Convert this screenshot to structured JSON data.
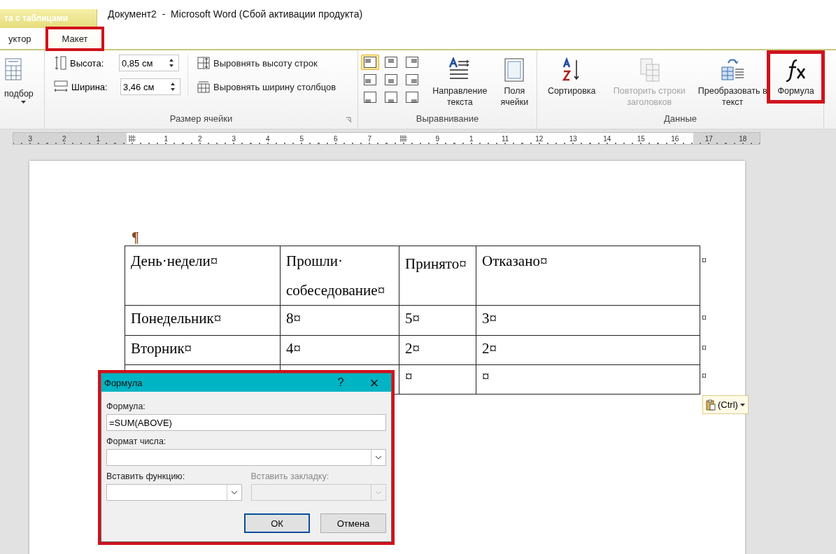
{
  "title_bar": {
    "context_tab": "та с таблицами",
    "title": "Документ2  -  Microsoft Word (Сбой активации продукта)"
  },
  "tabs": [
    {
      "label": "уктор",
      "selected": false,
      "highlighted": false
    },
    {
      "label": "Макет",
      "selected": true,
      "highlighted": true
    }
  ],
  "ribbon": {
    "autofit": {
      "label": "подбор"
    },
    "cell_size": {
      "label": "Размер ячейки",
      "fields": [
        {
          "kind": "height",
          "label": "Высота:",
          "value": "0,85 см"
        },
        {
          "kind": "width",
          "label": "Ширина:",
          "value": "3,46 см"
        }
      ],
      "buttons": [
        {
          "kind": "rows",
          "label": "Выровнять высоту строк"
        },
        {
          "kind": "cols",
          "label": "Выровнять ширину столбцов"
        }
      ]
    },
    "alignment": {
      "label": "Выравнивание",
      "cells": [
        {
          "selected": true
        },
        {
          "selected": false
        },
        {
          "selected": false
        },
        {
          "selected": false
        },
        {
          "selected": false
        },
        {
          "selected": false
        },
        {
          "selected": false
        },
        {
          "selected": false
        },
        {
          "selected": false
        }
      ],
      "buttons": [
        {
          "kind": "direction",
          "label": "Направление текста"
        },
        {
          "kind": "margins",
          "label": "Поля ячейки"
        }
      ]
    },
    "data": {
      "label": "Данные",
      "buttons": [
        {
          "kind": "sort",
          "label": "Сортировка",
          "disabled": false,
          "highlighted": false
        },
        {
          "kind": "repeat",
          "label": "Повторить строки заголовков",
          "disabled": true,
          "highlighted": false
        },
        {
          "kind": "convert",
          "label": "Преобразовать в текст",
          "disabled": false,
          "highlighted": false
        },
        {
          "kind": "formula",
          "label": "Формула",
          "disabled": false,
          "highlighted": true
        }
      ]
    }
  },
  "ruler": [
    {
      "kind": "number",
      "label": "3"
    },
    {
      "kind": "number",
      "label": "2"
    },
    {
      "kind": "number",
      "label": "1"
    },
    {
      "kind": "marker"
    },
    {
      "kind": "number",
      "label": "1"
    },
    {
      "kind": "number",
      "label": "2"
    },
    {
      "kind": "number",
      "label": "3"
    },
    {
      "kind": "number",
      "label": "4"
    },
    {
      "kind": "number",
      "label": "5"
    },
    {
      "kind": "number",
      "label": "6"
    },
    {
      "kind": "number",
      "label": "7"
    },
    {
      "kind": "marker"
    },
    {
      "kind": "number",
      "label": "9"
    },
    {
      "kind": "number",
      "label": "1"
    },
    {
      "kind": "number",
      "label": "11"
    },
    {
      "kind": "number",
      "label": "12"
    },
    {
      "kind": "number",
      "label": "13"
    },
    {
      "kind": "number",
      "label": "14"
    },
    {
      "kind": "number",
      "label": "15"
    },
    {
      "kind": "number",
      "label": "16"
    },
    {
      "kind": "number",
      "label": "17"
    },
    {
      "kind": "number",
      "label": "18"
    }
  ],
  "document": {
    "pilcrow": "¶",
    "table": {
      "rows": [
        {
          "cells": [
            "День·недели¤",
            "Прошли· собеседование¤",
            "Принято¤",
            "Отказано¤"
          ],
          "end": "¤"
        },
        {
          "cells": [
            "Понедельник¤",
            "8¤",
            "5¤",
            "3¤"
          ],
          "end": "¤"
        },
        {
          "cells": [
            "Вторник¤",
            "4¤",
            "2¤",
            "2¤"
          ],
          "end": "¤"
        },
        {
          "cells": [
            "",
            "",
            "¤",
            "¤"
          ],
          "end": "¤"
        }
      ]
    },
    "paste_options": "(Ctrl)"
  },
  "dialog": {
    "title": "Формула",
    "help": "?",
    "close": "×",
    "highlighted": true,
    "formula": {
      "label": "Формула:",
      "value": "=SUM(ABOVE)"
    },
    "number_format": {
      "label": "Формат числа:"
    },
    "function": {
      "label": "Вставить функцию:",
      "disabled": false
    },
    "bookmark": {
      "label": "Вставить закладку:",
      "disabled": true
    },
    "buttons": [
      {
        "label": "ОК",
        "default": true
      },
      {
        "label": "Отмена",
        "default": false
      }
    ]
  }
}
